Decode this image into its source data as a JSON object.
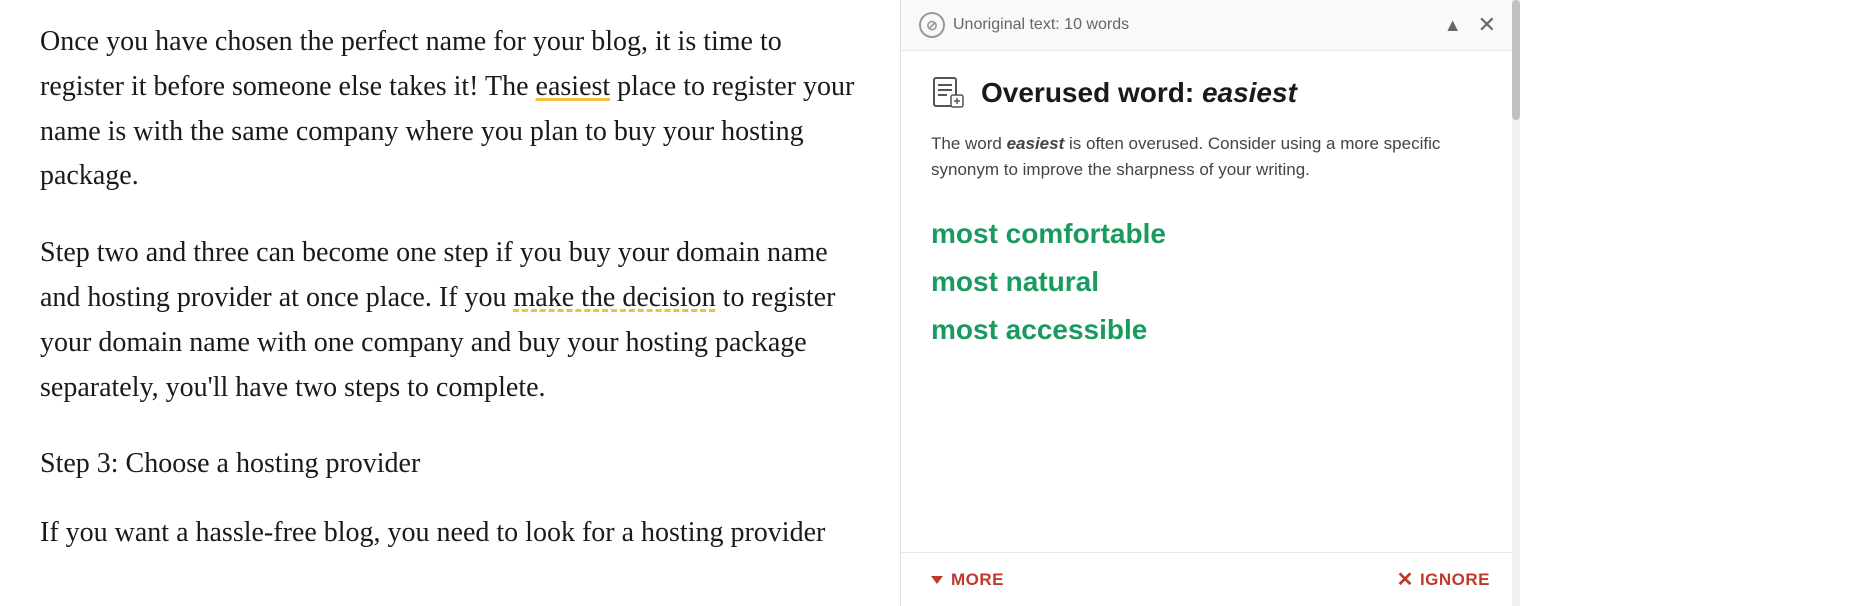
{
  "main": {
    "paragraph1_part1": "Once you have chosen the perfect name for your blog, it is time to register it before someone else takes it! The ",
    "easiest_word": "easiest",
    "paragraph1_part2": " place to register your name is with the same company where you plan to buy your hosting package.",
    "paragraph2_part1": "Step two and three can become one step if you buy your domain name and hosting provider at once place. If you ",
    "make_the_decision": "make the decision",
    "paragraph2_part2": " to register your domain name with one company and buy your hosting package separately, you'll have two steps to complete.",
    "heading": "Step 3: Choose a hosting provider",
    "paragraph3": "If you want a hassle-free blog, you need to look for a hosting provider"
  },
  "sidebar": {
    "header_text": "Unoriginal text: 10 words",
    "title_prefix": "Overused word: ",
    "title_word": "easiest",
    "description_part1": "The word ",
    "description_word": "easiest",
    "description_part2": " is often overused. Consider using a more specific synonym to improve the sharpness of your writing.",
    "suggestions": [
      "most comfortable",
      "most natural",
      "most accessible"
    ],
    "more_label": "MORE",
    "ignore_label": "IGNORE",
    "nav_up": "▲",
    "nav_close": "✕"
  },
  "colors": {
    "green": "#1a9b5e",
    "red": "#c0392b",
    "yellow_underline": "#f0c040"
  }
}
